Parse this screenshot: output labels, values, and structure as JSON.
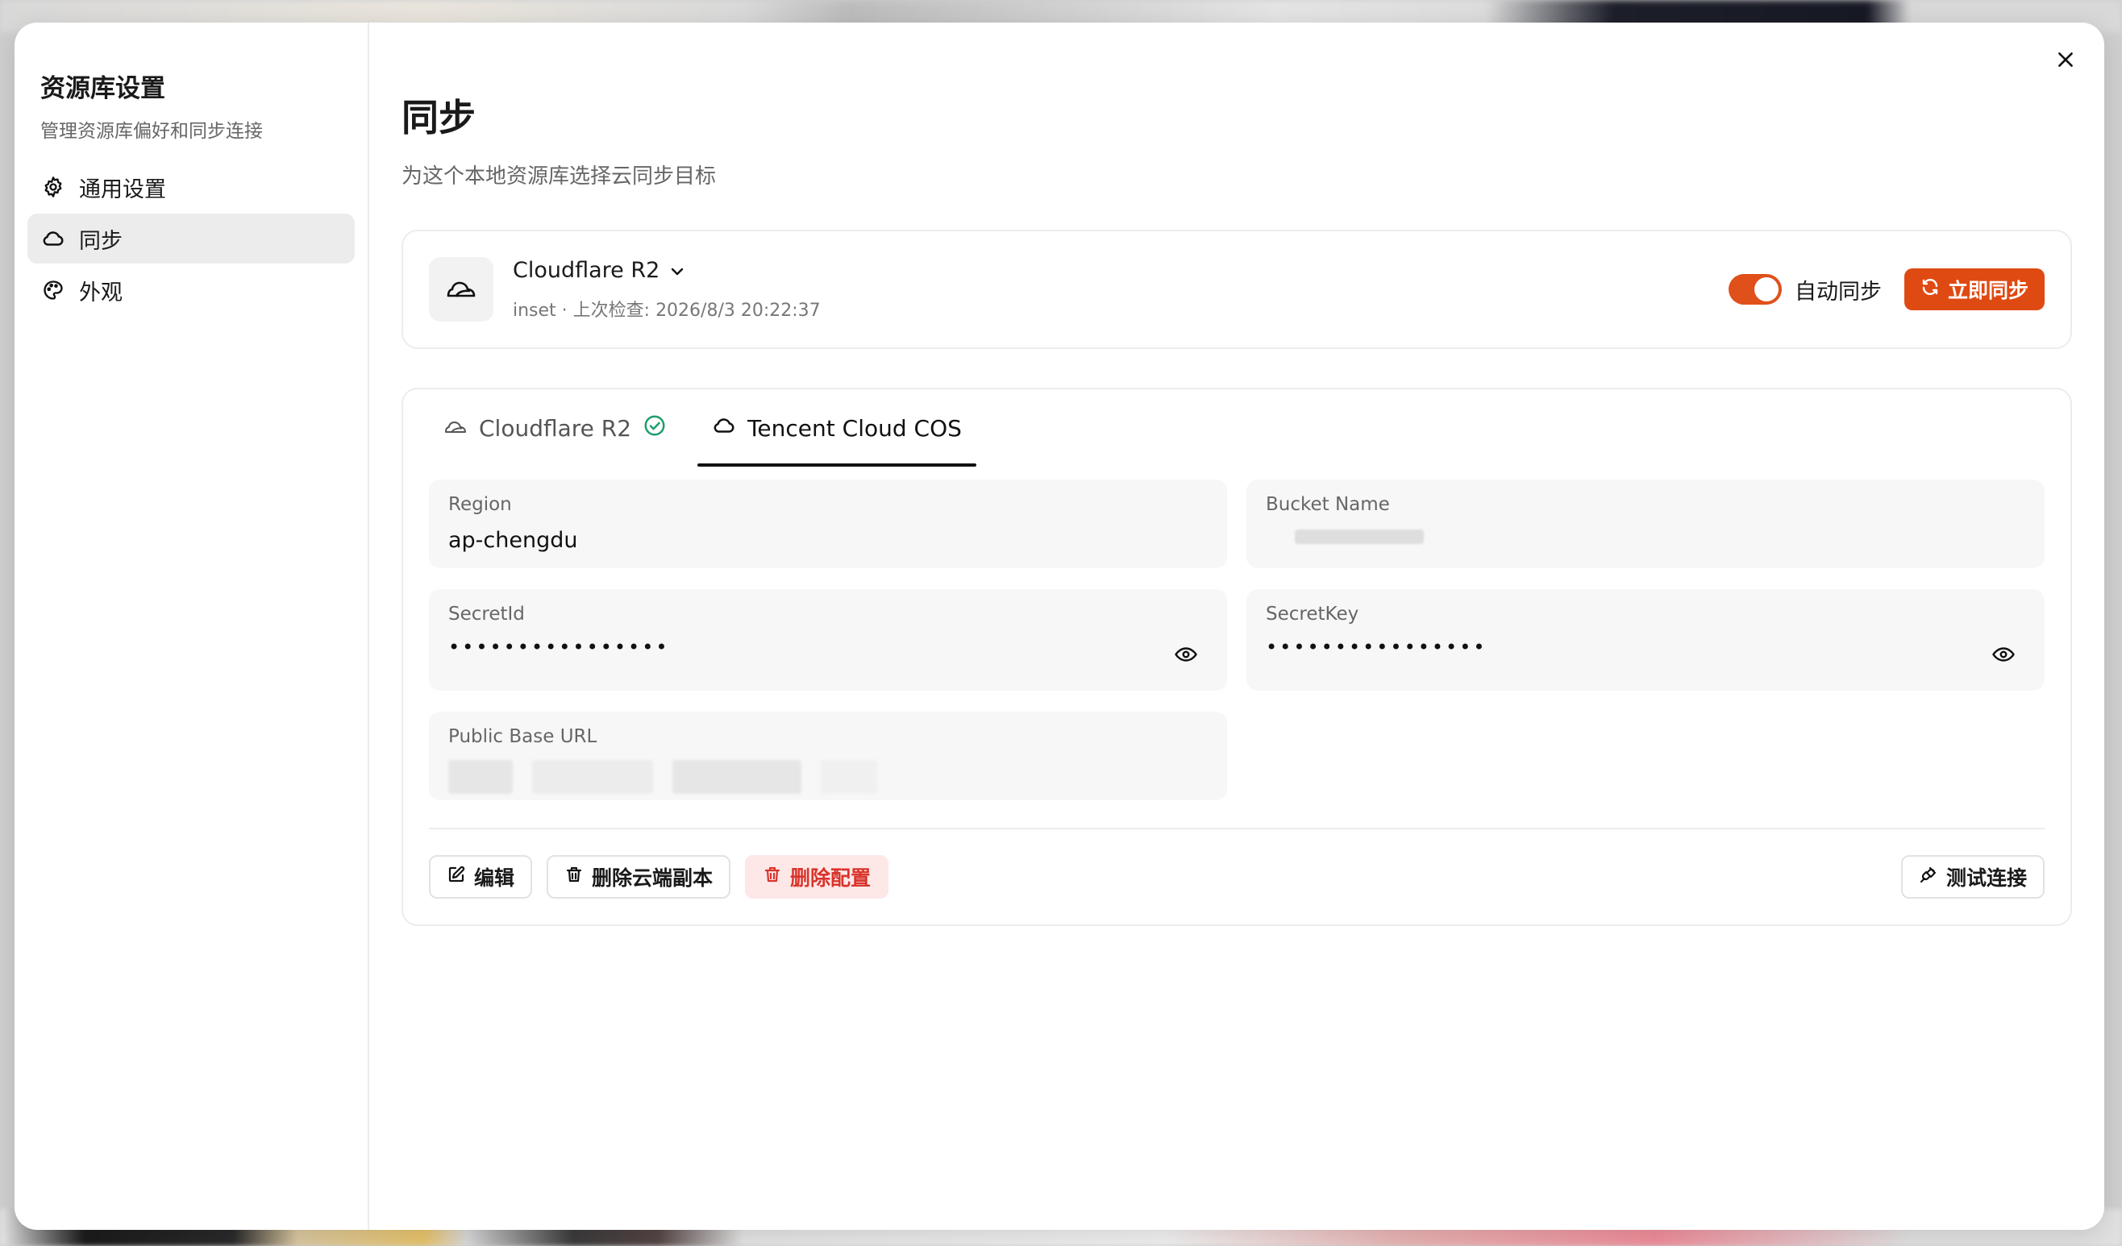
{
  "sidebar": {
    "title": "资源库设置",
    "subtitle": "管理资源库偏好和同步连接",
    "items": [
      {
        "label": "通用设置",
        "icon": "gear-icon"
      },
      {
        "label": "同步",
        "icon": "cloud-icon",
        "active": true
      },
      {
        "label": "外观",
        "icon": "palette-icon"
      }
    ]
  },
  "main": {
    "title": "同步",
    "subtitle": "为这个本地资源库选择云同步目标"
  },
  "provider": {
    "name": "Cloudflare R2",
    "meta": "inset · 上次检查: 2026/8/3 20:22:37",
    "auto_sync_label": "自动同步",
    "auto_sync_on": true,
    "sync_now_label": "立即同步",
    "accent_color": "#df4a12"
  },
  "config": {
    "tabs": [
      {
        "label": "Cloudflare R2",
        "verified": true,
        "active": false
      },
      {
        "label": "Tencent Cloud COS",
        "verified": false,
        "active": true
      }
    ],
    "fields": {
      "region": {
        "label": "Region",
        "value": "ap-chengdu"
      },
      "bucket": {
        "label": "Bucket Name"
      },
      "secret_id": {
        "label": "SecretId",
        "value": "••••••••••••••••"
      },
      "secret_key": {
        "label": "SecretKey",
        "value": "••••••••••••••••"
      },
      "public_url": {
        "label": "Public Base URL"
      }
    },
    "actions": {
      "edit": "编辑",
      "delete_cloud": "删除云端副本",
      "delete_config": "删除配置",
      "test": "测试连接"
    }
  }
}
